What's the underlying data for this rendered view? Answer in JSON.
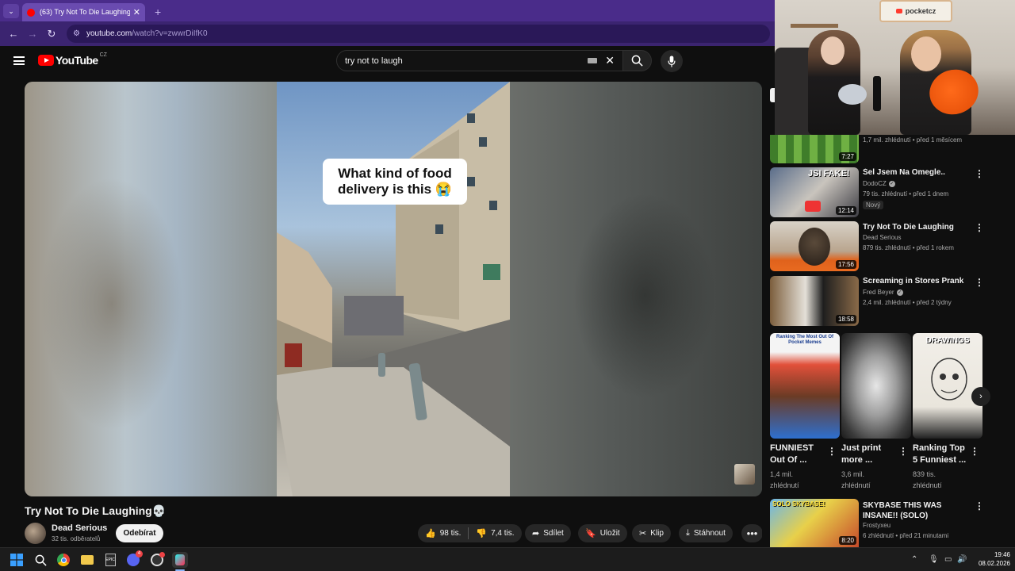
{
  "colors": {
    "tab_strip": "#4a2c8a",
    "youtube_red": "#ff0000",
    "background": "#0f0f0f",
    "pill_bg": "#272727",
    "plate_orange": "#ff6a1a"
  },
  "browser": {
    "tab": {
      "title": "(63) Try Not To Die Laughing💀",
      "close": "✕"
    },
    "new_tab": "+",
    "url_host": "youtube.com",
    "url_path": "/watch?v=zwwrDiIfK0"
  },
  "header": {
    "logo_text": "YouTube",
    "country": "CZ",
    "search_value": "try not to laugh"
  },
  "video": {
    "caption": "What kind of food delivery is this 😭",
    "title": "Try Not To Die Laughing💀",
    "channel": "Dead Serious",
    "subscribers": "32 tis. odběratelů",
    "subscribe_label": "Odebírat",
    "likes": "98 tis.",
    "dislikes": "7,4 tis.",
    "share_label": "Sdílet",
    "save_label": "Uložit",
    "clip_label": "Klip",
    "download_label": "Stáhnout",
    "more_label": "•••"
  },
  "webcam": {
    "sign_text": "pocketcz"
  },
  "recommendations": [
    {
      "title": "",
      "channel": "",
      "meta": "1,7 mil. zhlédnutí • před 1 měsícem",
      "duration": "7:27"
    },
    {
      "title": "Šel Jsem Na Omegle..",
      "channel": "DodoCZ",
      "meta": "79 tis. zhlédnutí • před 1 dnem",
      "duration": "12:14",
      "badge": "Nový",
      "thumb_text": "JSI FAKE!"
    },
    {
      "title": "Try Not To Die Laughing",
      "channel": "Dead Serious",
      "meta": "879 tis. zhlédnutí • před 1 rokem",
      "duration": "17:56"
    },
    {
      "title": "Screaming in Stores Prank",
      "channel": "Fred Beyer",
      "meta": "2,4 mil. zhlédnutí • před 2 týdny",
      "duration": "18:58"
    },
    {
      "title": "SKYBASE THIS WAS INSANE!! (SOLO)",
      "channel": "Frostyxeu",
      "meta": "6 zhlédnutí • před 21 minutami",
      "duration": "8:20",
      "thumb_text": "SOLO SKYBASE!"
    }
  ],
  "shorts": [
    {
      "title_l1": "FUNNIEST",
      "title_l2": "Out Of ...",
      "views_l1": "1,4 mil.",
      "views_l2": "zhlédnutí",
      "thumb_text": "Ranking The Most Out Of Pocket Memes"
    },
    {
      "title_l1": "Just print",
      "title_l2": "more ...",
      "views_l1": "3,6 mil.",
      "views_l2": "zhlédnutí"
    },
    {
      "title_l1": "Ranking Top",
      "title_l2": "5 Funniest ...",
      "views_l1": "839 tis.",
      "views_l2": "zhlédnutí",
      "thumb_text": "DRAWINGS"
    }
  ],
  "taskbar": {
    "time": "19:46",
    "date": "08.02.2026",
    "discord_badge": "4"
  }
}
